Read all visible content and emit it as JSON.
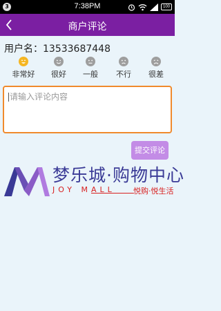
{
  "status_bar": {
    "notification_count": "3",
    "time": "7:38PM",
    "battery": "100"
  },
  "header": {
    "title": "商户评论"
  },
  "user": {
    "label": "用户名：",
    "value": "13533687448"
  },
  "ratings": [
    {
      "label": "非常好",
      "face": "very-happy",
      "selected": true
    },
    {
      "label": "很好",
      "face": "happy",
      "selected": false
    },
    {
      "label": "一般",
      "face": "neutral",
      "selected": false
    },
    {
      "label": "不行",
      "face": "sad",
      "selected": false
    },
    {
      "label": "很差",
      "face": "very-sad",
      "selected": false
    }
  ],
  "comment": {
    "placeholder": "请输入评论内容"
  },
  "submit": {
    "label": "提交评论"
  },
  "logo": {
    "cn_name": "梦乐城·购物中心",
    "en_name": "JOY MALL",
    "slogan": "悦购·悦生活"
  },
  "colors": {
    "header": "#7b1fa2",
    "submit_button": "#c38ce6",
    "comment_border": "#f08a2c",
    "selected_face": "#f5b623",
    "unselected_face": "#9e9e9e",
    "background": "#eaf4fa"
  }
}
